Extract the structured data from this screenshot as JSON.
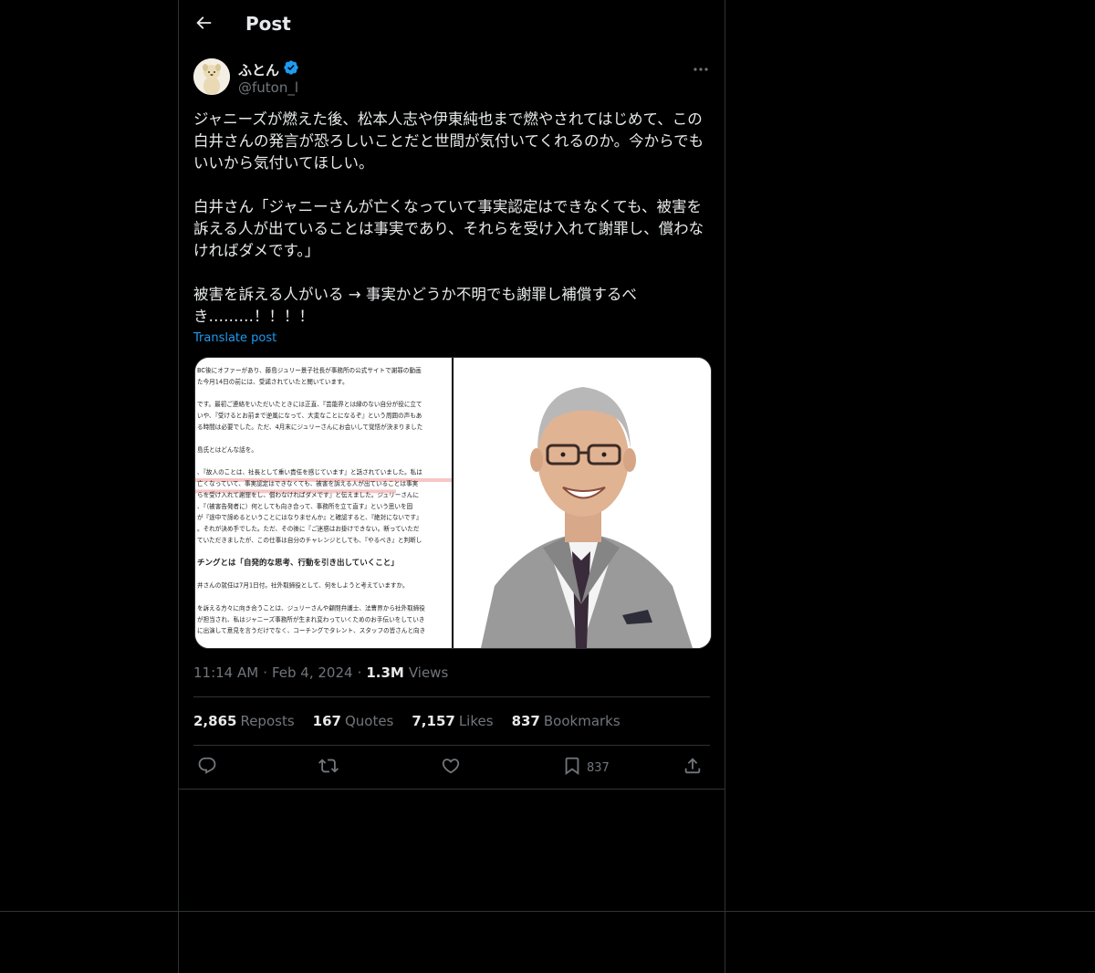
{
  "header": {
    "title": "Post"
  },
  "author": {
    "name": "ふとん",
    "handle": "@futon_l",
    "verified": true
  },
  "post": {
    "text": "ジャニーズが燃えた後、松本人志や伊東純也まで燃やされてはじめて、この白井さんの発言が恐ろしいことだと世間が気付いてくれるのか。今からでもいいから気付いてほしい。\n\n白井さん「ジャニーさんが亡くなっていて事実認定はできなくても、被害を訴える人が出ていることは事実であり、それらを受け入れて謝罪し、償わなければダメです。」\n\n被害を訴える人がいる → 事実かどうか不明でも謝罪し補償するべき………！！！！",
    "translate_label": "Translate post",
    "time": "11:14 AM",
    "date": "Feb 4, 2024",
    "views_count": "1.3M",
    "views_label": "Views"
  },
  "media": {
    "article_lines": [
      "BC後にオファーがあり、藤島ジュリー景子社長が事務所の公式サイトで謝罪の動画",
      "た今月14日の前には、受諾されていたと聞いています。",
      "",
      "です。最初ご連絡をいただいたときには正直、『芸能界とは縁のない自分が役に立て",
      "いや、『受けるとお前まで逆風になって、大変なことになるぞ』という周囲の声もあ",
      "る時間は必要でした。ただ、4月末にジュリーさんにお会いして覚悟が決まりました",
      "",
      "島氏とはどんな話を。",
      "",
      "、『故人のことは、社長として重い責任を感じています』と話されていました。私は",
      "亡くなっていて、事実認定はできなくても、被害を訴える人が出ていることは事実",
      "らを受け入れて謝罪をし、償わなければダメです』と伝えました。ジュリーさんに",
      "、『（被害告発者に）何としても向き合って、事務所を立て直す』という思いを固",
      "が『途中で諦めるということにはなりませんか』と確認すると、『絶対にないです』",
      "。それが決め手でした。ただ、その後に『ご迷惑はお掛けできない。断っていただ",
      "ていただきましたが、この仕事は自分のチャレンジとしても、『やるべき』と判断し",
      "",
      "チングとは「自発的な思考、行動を引き出していくこと」",
      "",
      "井さんの就任は7月1日付。社外取締役として、何をしようと考えていますか。",
      "",
      "を訴える方々に向き合うことは、ジュリーさんや顧問弁護士、法曹界から社外取締役",
      "が担当され、私はジャニーズ事務所が生まれ変わっていくためのお手伝いをしていき",
      "に出演して意見を言うだけでなく、コーチングでタレント、スタッフの皆さんと向き"
    ]
  },
  "stats": [
    {
      "count": "2,865",
      "label": "Reposts"
    },
    {
      "count": "167",
      "label": "Quotes"
    },
    {
      "count": "7,157",
      "label": "Likes"
    },
    {
      "count": "837",
      "label": "Bookmarks"
    }
  ],
  "actions": {
    "bookmark_count": "837"
  },
  "colors": {
    "accent": "#1d9bf0",
    "muted": "#71767b",
    "border": "#2f3336",
    "verified": "#1d9bf0",
    "highlight": "#f7c6c6"
  },
  "icons": {
    "back": "arrow-left-icon",
    "verified": "verified-badge-icon",
    "more": "more-horizontal-icon",
    "reply": "reply-icon",
    "repost": "repost-icon",
    "like": "heart-icon",
    "bookmark": "bookmark-icon",
    "share": "share-icon"
  }
}
